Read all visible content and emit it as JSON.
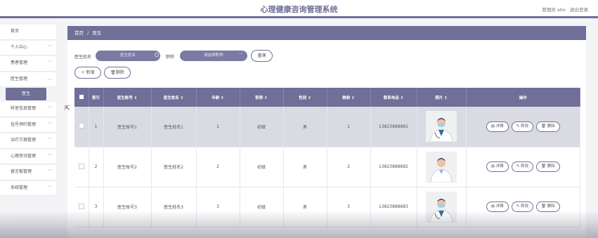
{
  "header": {
    "app_title": "心理健康咨询管理系统",
    "user_text": "管理员 abo",
    "logout_label": "退出登录"
  },
  "sidebar": {
    "items": [
      {
        "label": "首页",
        "has_chevron": false
      },
      {
        "label": "个人中心",
        "has_chevron": true
      },
      {
        "label": "患者管理",
        "has_chevron": true
      },
      {
        "label": "医生管理",
        "has_chevron": true
      },
      {
        "label": "科室信息管理",
        "has_chevron": true
      },
      {
        "label": "挂号预约管理",
        "has_chevron": true
      },
      {
        "label": "治疗方案管理",
        "has_chevron": true
      },
      {
        "label": "心理资讯管理",
        "has_chevron": true
      },
      {
        "label": "留言板管理",
        "has_chevron": true
      },
      {
        "label": "系统管理",
        "has_chevron": true
      }
    ],
    "active_sub": "医生"
  },
  "breadcrumb": {
    "home": "首页",
    "sep": "/",
    "current": "医生"
  },
  "search": {
    "name_label": "医生姓名",
    "name_placeholder": "医生姓名",
    "title_label": "职称",
    "title_placeholder": "请选择职称",
    "query_label": "查询"
  },
  "actions": {
    "add_label": "+ 新增",
    "delete_label": "删除"
  },
  "table": {
    "columns": [
      "",
      "索引",
      "医生账号 ⇕",
      "医生姓名 ⇕",
      "年龄 ⇕",
      "职称 ⇕",
      "性别 ⇕",
      "教龄 ⇕",
      "联系电话 ⇕",
      "照片 ⇕",
      "操作"
    ],
    "rows": [
      {
        "index": "1",
        "account": "医生账号1",
        "name": "医生姓名1",
        "age": "1",
        "title": "初级",
        "gender": "男",
        "teach": "1",
        "phone": "13823888881"
      },
      {
        "index": "2",
        "account": "医生账号2",
        "name": "医生姓名2",
        "age": "2",
        "title": "初级",
        "gender": "男",
        "teach": "2",
        "phone": "13823888882"
      },
      {
        "index": "3",
        "account": "医生账号3",
        "name": "医生姓名3",
        "age": "3",
        "title": "初级",
        "gender": "男",
        "teach": "3",
        "phone": "13823888883"
      }
    ],
    "op_detail": "详情",
    "op_edit": "修改",
    "op_delete": "删除"
  },
  "colors": {
    "accent": "#6f6f97",
    "row_highlight": "#dadae3"
  }
}
